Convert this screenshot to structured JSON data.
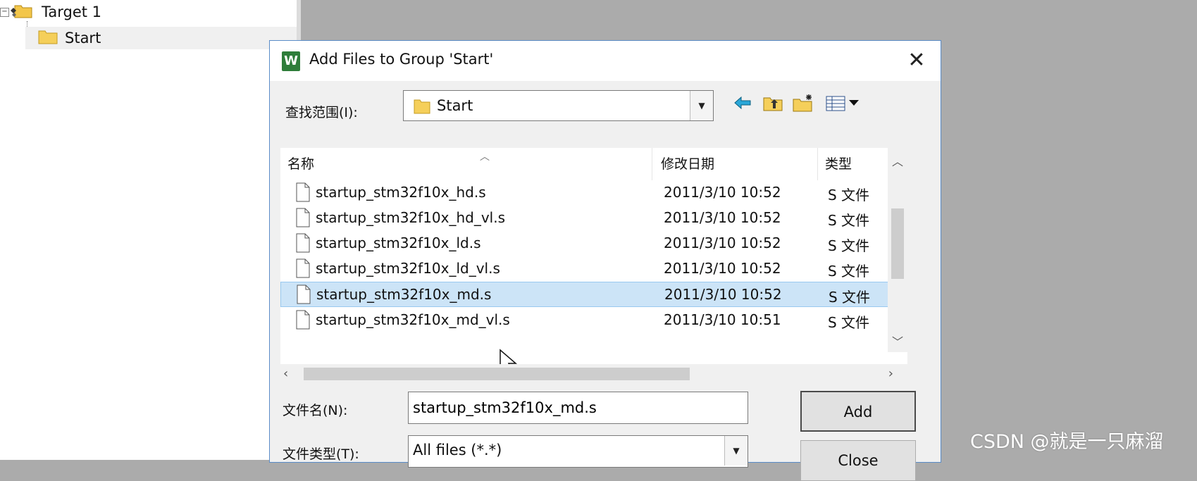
{
  "project_tree": {
    "target_label": "Target 1",
    "group_label": "Start"
  },
  "dialog": {
    "title": "Add Files to Group 'Start'",
    "close_glyph": "✕",
    "look_in_label": "查找范围(I):",
    "look_in_value": "Start",
    "toolbar": [
      "back-arrow-icon",
      "up-folder-icon",
      "new-folder-icon",
      "view-menu-icon"
    ],
    "columns": {
      "name": "名称",
      "modified": "修改日期",
      "type": "类型"
    },
    "files": [
      {
        "name": "startup_stm32f10x_hd.s",
        "modified": "2011/3/10 10:52",
        "type": "S 文件"
      },
      {
        "name": "startup_stm32f10x_hd_vl.s",
        "modified": "2011/3/10 10:52",
        "type": "S 文件"
      },
      {
        "name": "startup_stm32f10x_ld.s",
        "modified": "2011/3/10 10:52",
        "type": "S 文件"
      },
      {
        "name": "startup_stm32f10x_ld_vl.s",
        "modified": "2011/3/10 10:52",
        "type": "S 文件"
      },
      {
        "name": "startup_stm32f10x_md.s",
        "modified": "2011/3/10 10:52",
        "type": "S 文件",
        "selected": true
      },
      {
        "name": "startup_stm32f10x_md_vl.s",
        "modified": "2011/3/10 10:51",
        "type": "S 文件"
      }
    ],
    "filename_label": "文件名(N):",
    "filename_value": "startup_stm32f10x_md.s",
    "filetype_label": "文件类型(T):",
    "filetype_value": "All files (*.*)",
    "add_button": "Add",
    "close_button": "Close"
  },
  "watermark": "CSDN @就是一只麻溜",
  "colors": {
    "desktop_bg": "#ababab",
    "selection_bg": "#cce4f7",
    "selection_border": "#99c9ef",
    "dialog_border": "#5a8cc8"
  }
}
